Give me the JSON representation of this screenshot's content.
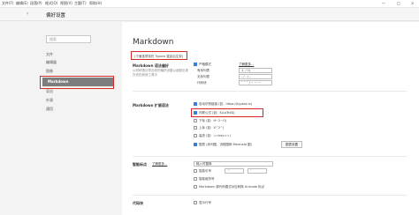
{
  "menubar": {
    "items": [
      "文件(F)",
      "编辑(E)",
      "段落(P)",
      "格式(O)",
      "视图(V)",
      "主题(T)",
      "帮助(H)"
    ],
    "minimize": "—",
    "maximize": "□",
    "close": "×"
  },
  "titlebar": {
    "back": "‹",
    "title": "偏好设置"
  },
  "sidebar": {
    "search_placeholder": "搜索",
    "items": [
      {
        "label": "文件"
      },
      {
        "label": "编辑器"
      },
      {
        "label": "图像"
      },
      {
        "label": "Markdown"
      },
      {
        "label": "导出"
      },
      {
        "label": "外观"
      },
      {
        "label": "通用"
      }
    ],
    "active_index": 3
  },
  "main": {
    "title": "Markdown",
    "tip": "(下面选项将在 Typora 重启后生效)",
    "syntax": {
      "label": "Markdown 语法偏好",
      "desc": "以何种语法导出你的偏好设置以适配出现在你的其他工具中",
      "strict": "严格模式",
      "learn_more": "了解更多...",
      "list_style": {
        "label": "有序列表",
        "value": "1. / 1)"
      },
      "indent": {
        "label": "无序列表",
        "value": "- / - / -"
      },
      "code": {
        "label": "代码块",
        "value": "` ` ` / ~ ~ ~"
      }
    },
    "extended": {
      "label": "Markdown 扩展语法",
      "items": [
        {
          "label": "自动识别链接",
          "hint": "(如：https://typora.io)",
          "checked": true
        },
        {
          "label": "内联公式",
          "hint": "(如：$\\LaTeX$)",
          "checked": true
        },
        {
          "label": "下标",
          "hint": "(如：H~2~O)",
          "checked": false
        },
        {
          "label": "上标",
          "hint": "(如：X^2^)",
          "checked": false
        },
        {
          "label": "高亮",
          "hint": "(如：==key==)",
          "checked": false
        },
        {
          "label": "图表 (序列图，流程图和 Mermaid 图)",
          "hint": "",
          "checked": true
        }
      ],
      "button": "图表设置"
    },
    "smart": {
      "label": "智能标点",
      "learn_more": "了解更多...",
      "mode": "输入时替换",
      "quotes": {
        "label": "智能引号",
        "values": [
          "\"\"",
          "''"
        ]
      },
      "dash": {
        "label": "智能破折号"
      },
      "unicode": {
        "label": "Markdown 源代码模式对应转换 Unicode 标点"
      }
    },
    "codeblock": {
      "label": "代码块",
      "line_numbers": "显示行号"
    }
  }
}
